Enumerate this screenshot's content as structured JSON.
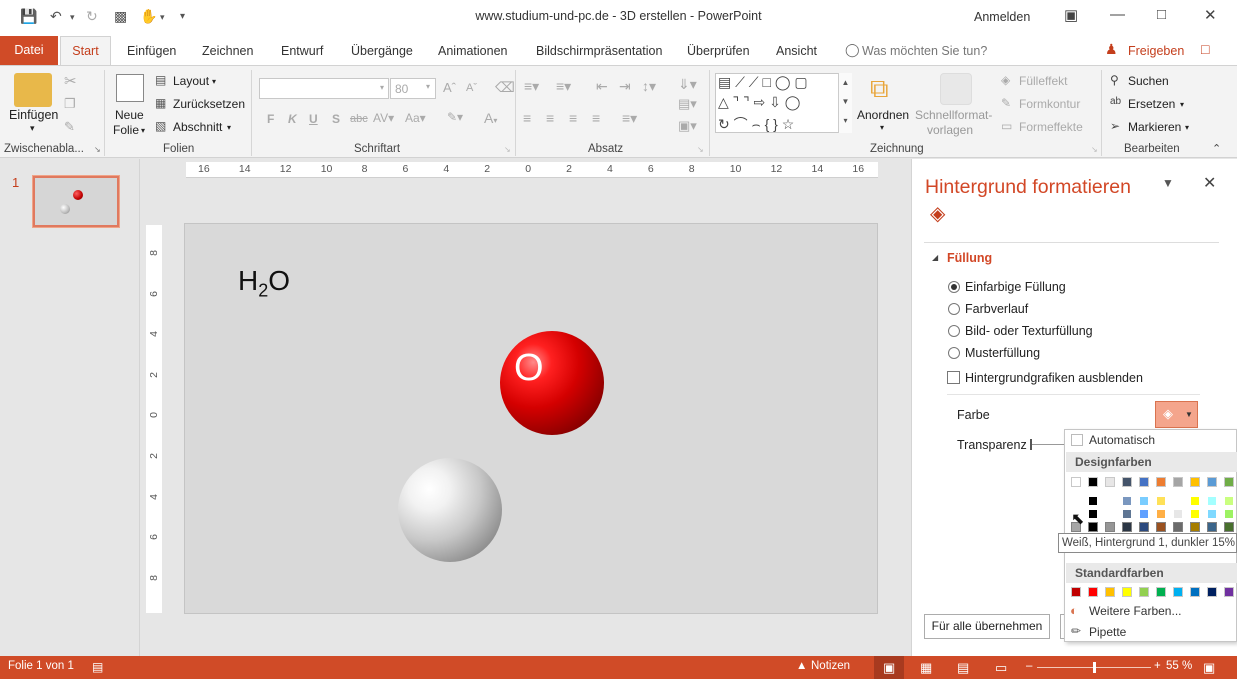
{
  "window": {
    "title": "www.studium-und-pc.de - 3D erstellen  -  PowerPoint",
    "signin": "Anmelden"
  },
  "tabs": {
    "file": "Datei",
    "start": "Start",
    "items": [
      "Einfügen",
      "Zeichnen",
      "Entwurf",
      "Übergänge",
      "Animationen",
      "Bildschirmpräsentation",
      "Überprüfen",
      "Ansicht"
    ],
    "tellme": "Was möchten Sie tun?",
    "share": "Freigeben"
  },
  "ribbon": {
    "clipboard": {
      "paste": "Einfügen",
      "label": "Zwischenabla..."
    },
    "slides": {
      "new_slide_1": "Neue",
      "new_slide_2": "Folie",
      "layout": "Layout",
      "reset": "Zurücksetzen",
      "section": "Abschnitt",
      "label": "Folien"
    },
    "font": {
      "font_name": "",
      "font_size": "80",
      "bold": "F",
      "italic": "K",
      "underline": "U",
      "shadow": "S",
      "strike": "abc",
      "label": "Schriftart"
    },
    "paragraph": {
      "label": "Absatz"
    },
    "drawing": {
      "arrange": "Anordnen",
      "quickstyles_1": "Schnellformat-",
      "quickstyles_2": "vorlagen",
      "fill": "Fülleffekt",
      "outline": "Formkontur",
      "effects": "Formeffekte",
      "label": "Zeichnung"
    },
    "editing": {
      "find": "Suchen",
      "replace": "Ersetzen",
      "select": "Markieren",
      "label": "Bearbeiten"
    }
  },
  "slides_panel": {
    "number": "1"
  },
  "ruler": {
    "h_ticks": [
      "16",
      "14",
      "12",
      "10",
      "8",
      "6",
      "4",
      "2",
      "0",
      "2",
      "4",
      "6",
      "8",
      "10",
      "12",
      "14",
      "16"
    ],
    "v_ticks": [
      "8",
      "6",
      "4",
      "2",
      "0",
      "2",
      "4",
      "6",
      "8"
    ]
  },
  "slide": {
    "text_main": "H",
    "text_sub": "2",
    "text_end": "O",
    "red_label": "O"
  },
  "pane": {
    "title": "Hintergrund formatieren",
    "section": "Füllung",
    "options": [
      {
        "label": "Einfarbige Füllung",
        "selected": true
      },
      {
        "label": "Farbverlauf",
        "selected": false
      },
      {
        "label": "Bild- oder Texturfüllung",
        "selected": false
      },
      {
        "label": "Musterfüllung",
        "selected": false
      }
    ],
    "hide_graphics": "Hintergrundgrafiken ausblenden",
    "color_label": "Farbe",
    "transparency_label": "Transparenz",
    "apply_all": "Für alle übernehmen"
  },
  "color_menu": {
    "automatic": "Automatisch",
    "theme_colors": "Designfarben",
    "standard_colors": "Standardfarben",
    "more_colors": "Weitere Farben...",
    "eyedropper": "Pipette",
    "tooltip": "Weiß, Hintergrund 1, dunkler 15%",
    "theme_top": [
      "#ffffff",
      "#000000",
      "#e7e6e6",
      "#44546a",
      "#4472c4",
      "#ed7d31",
      "#a5a5a5",
      "#ffc000",
      "#5b9bd5",
      "#70ad47"
    ],
    "standard": [
      "#c00000",
      "#ff0000",
      "#ffc000",
      "#ffff00",
      "#92d050",
      "#00b050",
      "#00b0f0",
      "#0070c0",
      "#002060",
      "#7030a0"
    ]
  },
  "status": {
    "slide_info": "Folie 1 von 1",
    "notes": "Notizen",
    "zoom": "55 %"
  }
}
